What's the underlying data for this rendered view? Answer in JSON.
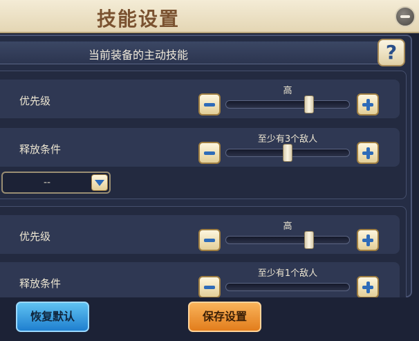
{
  "window": {
    "title": "技能设置"
  },
  "section": {
    "title": "当前装备的主动技能",
    "help_label": "?"
  },
  "skills": [
    {
      "priority_label": "优先级",
      "priority_value": "高",
      "priority_level": 0.67,
      "condition_label": "释放条件",
      "condition_value": "至少有3个敌人",
      "condition_level": 0.5,
      "dropdown_value": "--"
    },
    {
      "priority_label": "优先级",
      "priority_value": "高",
      "priority_level": 0.67,
      "condition_label": "释放条件",
      "condition_value": "至少有1个敌人"
    }
  ],
  "footer": {
    "restore_label": "恢复默认",
    "save_label": "保存设置"
  },
  "colors": {
    "restore_button": "#1f7fcf",
    "save_button": "#e27d1c",
    "title_bar": "#f4ecd6"
  },
  "icons": {
    "minimize": "minimize-icon",
    "help": "help-icon",
    "decrease": "minus-icon",
    "increase": "plus-icon",
    "dropdown": "chevron-down-icon"
  }
}
